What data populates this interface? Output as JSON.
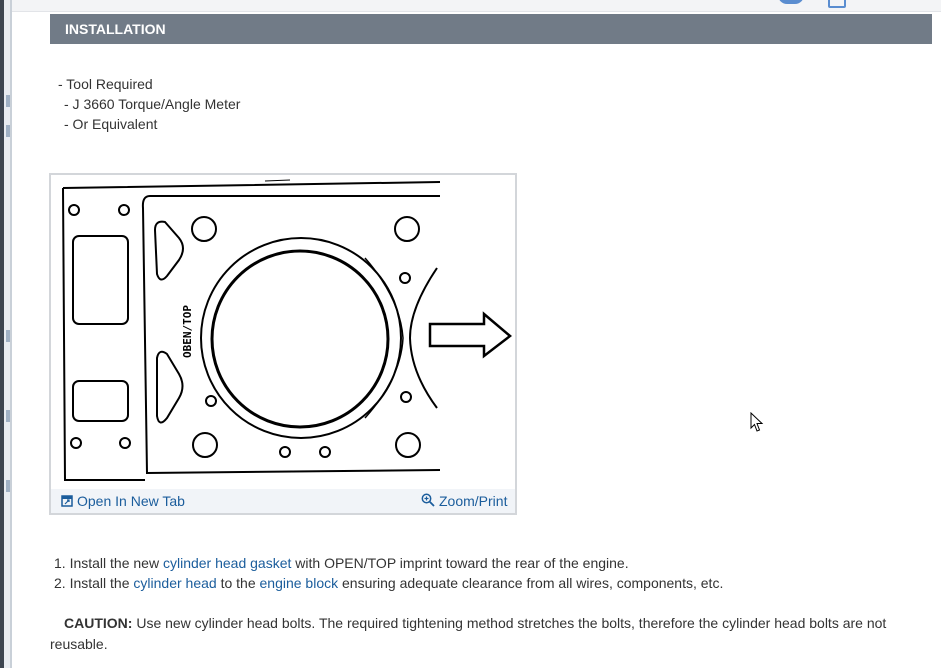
{
  "section": {
    "title": "INSTALLATION"
  },
  "tools": {
    "heading": "-  Tool Required",
    "items": [
      "-  J 3660 Torque/Angle Meter",
      "-  Or Equivalent"
    ]
  },
  "figure": {
    "diagram_label": "OBEN/TOP",
    "open_tab": "Open In New Tab",
    "zoom": "Zoom/Print"
  },
  "steps": [
    {
      "num": "1.",
      "pre": "Install the new ",
      "link1": "cylinder head gasket",
      "post": " with OPEN/TOP imprint toward the rear of the engine."
    },
    {
      "num": "2.",
      "pre": "Install the ",
      "link1": "cylinder head",
      "mid": " to the ",
      "link2": "engine block",
      "post": " ensuring adequate clearance from all wires, components, etc."
    }
  ],
  "caution": {
    "label": "CAUTION:",
    "line1": "Use new cylinder head bolts. The required tightening method stretches the bolts, therefore the cylinder head bolts are not",
    "line2": "reusable."
  },
  "icons": {
    "open_tab_icon": "open-in-new-tab-icon",
    "zoom_icon": "magnifier-icon",
    "cursor": "mouse-pointer-icon",
    "arrow": "right-arrow-icon"
  },
  "colors": {
    "header_bg": "#717b87",
    "link": "#1b5d9c",
    "text": "#333333"
  }
}
